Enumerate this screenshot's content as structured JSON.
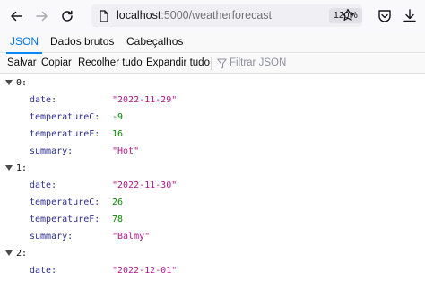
{
  "browser": {
    "url_host": "localhost",
    "url_path": ":5000/weatherforecast",
    "zoom": "120%"
  },
  "icons": {
    "back": "back-arrow-icon",
    "forward": "forward-arrow-icon",
    "reload": "reload-icon",
    "page": "page-info-icon",
    "bookmark": "star-icon",
    "pocket": "pocket-icon",
    "downloads": "download-icon",
    "filter": "filter-icon"
  },
  "tabs": [
    {
      "label": "JSON",
      "selected": true
    },
    {
      "label": "Dados brutos",
      "selected": false
    },
    {
      "label": "Cabeçalhos",
      "selected": false
    }
  ],
  "actions": {
    "save": "Salvar",
    "copy": "Copiar",
    "collapse_all": "Recolher tudo",
    "expand_all": "Expandir tudo",
    "filter_placeholder": "Filtrar JSON"
  },
  "json_rows": [
    {
      "kind": "index",
      "text": "0:"
    },
    {
      "kind": "field",
      "key": "date:",
      "value": "\"2022-11-29\"",
      "type": "str"
    },
    {
      "kind": "field",
      "key": "temperatureC:",
      "value": "-9",
      "type": "num"
    },
    {
      "kind": "field",
      "key": "temperatureF:",
      "value": "16",
      "type": "num"
    },
    {
      "kind": "field",
      "key": "summary:",
      "value": "\"Hot\"",
      "type": "str"
    },
    {
      "kind": "index",
      "text": "1:"
    },
    {
      "kind": "field",
      "key": "date:",
      "value": "\"2022-11-30\"",
      "type": "str"
    },
    {
      "kind": "field",
      "key": "temperatureC:",
      "value": "26",
      "type": "num"
    },
    {
      "kind": "field",
      "key": "temperatureF:",
      "value": "78",
      "type": "num"
    },
    {
      "kind": "field",
      "key": "summary:",
      "value": "\"Balmy\"",
      "type": "str"
    },
    {
      "kind": "index",
      "text": "2:"
    },
    {
      "kind": "field",
      "key": "date:",
      "value": "\"2022-12-01\"",
      "type": "str"
    }
  ],
  "colors": {
    "accent": "#0a84ff",
    "string_value": "#b0188c",
    "number_value": "#058b00",
    "key": "#2d2d8f"
  }
}
